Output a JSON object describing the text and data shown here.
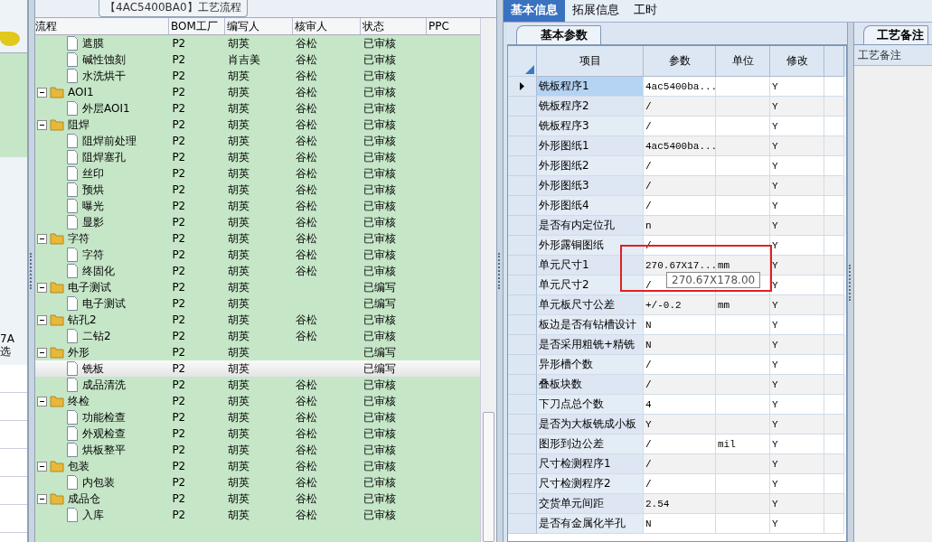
{
  "left_stub": {
    "texts": [
      "7A",
      "选"
    ]
  },
  "flow_panel": {
    "title": "【4AC5400BA0】工艺流程",
    "columns": [
      "流程",
      "BOM工厂",
      "编写人",
      "核审人",
      "状态",
      "PPC"
    ],
    "nodes": [
      {
        "kind": "continued",
        "children": [
          {
            "kind": "step",
            "name": "遮膜",
            "bom": "P2",
            "author": "胡英",
            "reviewer": "谷松",
            "status": "已审核",
            "selected": false
          },
          {
            "kind": "step",
            "name": "碱性蚀刻",
            "bom": "P2",
            "author": "肖吉美",
            "reviewer": "谷松",
            "status": "已审核",
            "selected": false
          },
          {
            "kind": "step",
            "name": "水洗烘干",
            "bom": "P2",
            "author": "胡英",
            "reviewer": "谷松",
            "status": "已审核",
            "selected": false
          }
        ]
      },
      {
        "kind": "group",
        "name": "AOI1",
        "bom": "P2",
        "author": "胡英",
        "reviewer": "谷松",
        "status": "已审核",
        "selected": false,
        "expanded": true,
        "children": [
          {
            "kind": "step",
            "name": "外层AOI1",
            "bom": "P2",
            "author": "胡英",
            "reviewer": "谷松",
            "status": "已审核",
            "selected": false
          }
        ]
      },
      {
        "kind": "group",
        "name": "阻焊",
        "bom": "P2",
        "author": "胡英",
        "reviewer": "谷松",
        "status": "已审核",
        "selected": false,
        "expanded": true,
        "children": [
          {
            "kind": "step",
            "name": "阻焊前处理",
            "bom": "P2",
            "author": "胡英",
            "reviewer": "谷松",
            "status": "已审核",
            "selected": false
          },
          {
            "kind": "step",
            "name": "阻焊塞孔",
            "bom": "P2",
            "author": "胡英",
            "reviewer": "谷松",
            "status": "已审核",
            "selected": false
          },
          {
            "kind": "step",
            "name": "丝印",
            "bom": "P2",
            "author": "胡英",
            "reviewer": "谷松",
            "status": "已审核",
            "selected": false
          },
          {
            "kind": "step",
            "name": "预烘",
            "bom": "P2",
            "author": "胡英",
            "reviewer": "谷松",
            "status": "已审核",
            "selected": false
          },
          {
            "kind": "step",
            "name": "曝光",
            "bom": "P2",
            "author": "胡英",
            "reviewer": "谷松",
            "status": "已审核",
            "selected": false
          },
          {
            "kind": "step",
            "name": "显影",
            "bom": "P2",
            "author": "胡英",
            "reviewer": "谷松",
            "status": "已审核",
            "selected": false
          }
        ]
      },
      {
        "kind": "group",
        "name": "字符",
        "bom": "P2",
        "author": "胡英",
        "reviewer": "谷松",
        "status": "已审核",
        "selected": false,
        "expanded": true,
        "children": [
          {
            "kind": "step",
            "name": "字符",
            "bom": "P2",
            "author": "胡英",
            "reviewer": "谷松",
            "status": "已审核",
            "selected": false
          },
          {
            "kind": "step",
            "name": "终固化",
            "bom": "P2",
            "author": "胡英",
            "reviewer": "谷松",
            "status": "已审核",
            "selected": false
          }
        ]
      },
      {
        "kind": "group",
        "name": "电子测试",
        "bom": "P2",
        "author": "胡英",
        "status": "已编写",
        "selected": false,
        "expanded": true,
        "children": [
          {
            "kind": "step",
            "name": "电子测试",
            "bom": "P2",
            "author": "胡英",
            "status": "已编写",
            "selected": false
          }
        ]
      },
      {
        "kind": "group",
        "name": "钻孔2",
        "bom": "P2",
        "author": "胡英",
        "reviewer": "谷松",
        "status": "已审核",
        "selected": false,
        "expanded": true,
        "children": [
          {
            "kind": "step",
            "name": "二钻2",
            "bom": "P2",
            "author": "胡英",
            "reviewer": "谷松",
            "status": "已审核",
            "selected": false
          }
        ]
      },
      {
        "kind": "group",
        "name": "外形",
        "bom": "P2",
        "author": "胡英",
        "status": "已编写",
        "selected": false,
        "expanded": true,
        "children": [
          {
            "kind": "step",
            "name": "铣板",
            "bom": "P2",
            "author": "胡英",
            "status": "已编写",
            "selected": true
          },
          {
            "kind": "step",
            "name": "成品清洗",
            "bom": "P2",
            "author": "胡英",
            "reviewer": "谷松",
            "status": "已审核",
            "selected": false
          }
        ]
      },
      {
        "kind": "group",
        "name": "终检",
        "bom": "P2",
        "author": "胡英",
        "reviewer": "谷松",
        "status": "已审核",
        "selected": false,
        "expanded": true,
        "children": [
          {
            "kind": "step",
            "name": "功能检查",
            "bom": "P2",
            "author": "胡英",
            "reviewer": "谷松",
            "status": "已审核",
            "selected": false
          },
          {
            "kind": "step",
            "name": "外观检查",
            "bom": "P2",
            "author": "胡英",
            "reviewer": "谷松",
            "status": "已审核",
            "selected": false
          },
          {
            "kind": "step",
            "name": "烘板整平",
            "bom": "P2",
            "author": "胡英",
            "reviewer": "谷松",
            "status": "已审核",
            "selected": false
          }
        ]
      },
      {
        "kind": "group",
        "name": "包装",
        "bom": "P2",
        "author": "胡英",
        "reviewer": "谷松",
        "status": "已审核",
        "selected": false,
        "expanded": true,
        "children": [
          {
            "kind": "step",
            "name": "内包装",
            "bom": "P2",
            "author": "胡英",
            "reviewer": "谷松",
            "status": "已审核",
            "selected": false
          }
        ]
      },
      {
        "kind": "group",
        "name": "成品仓",
        "bom": "P2",
        "author": "胡英",
        "reviewer": "谷松",
        "status": "已审核",
        "selected": false,
        "expanded": true,
        "children": [
          {
            "kind": "step",
            "name": "入库",
            "bom": "P2",
            "author": "胡英",
            "reviewer": "谷松",
            "status": "已审核",
            "selected": false
          }
        ]
      }
    ]
  },
  "tabs": [
    {
      "label": "基本信息",
      "selected": true
    },
    {
      "label": "拓展信息",
      "selected": false
    },
    {
      "label": "工时",
      "selected": false
    }
  ],
  "params_panel": {
    "tab": "基本参数",
    "columns": [
      "项目",
      "参数",
      "单位",
      "修改"
    ],
    "rows": [
      {
        "item": "铣板程序1",
        "value": "4ac5400ba...",
        "modify": "Y",
        "selected": true
      },
      {
        "item": "铣板程序2",
        "value": "/",
        "modify": "Y",
        "selected": false
      },
      {
        "item": "铣板程序3",
        "value": "/",
        "modify": "Y",
        "selected": false
      },
      {
        "item": "外形图纸1",
        "value": "4ac5400ba...",
        "modify": "Y",
        "selected": false
      },
      {
        "item": "外形图纸2",
        "value": "/",
        "modify": "Y",
        "selected": false
      },
      {
        "item": "外形图纸3",
        "value": "/",
        "modify": "Y",
        "selected": false
      },
      {
        "item": "外形图纸4",
        "value": "/",
        "modify": "Y",
        "selected": false
      },
      {
        "item": "是否有内定位孔",
        "value": "n",
        "modify": "Y",
        "selected": false
      },
      {
        "item": "外形露铜图纸",
        "value": "/",
        "modify": "Y",
        "selected": false
      },
      {
        "item": "单元尺寸1",
        "value": "270.67X17...",
        "unit": "mm",
        "modify": "Y",
        "selected": false
      },
      {
        "item": "单元尺寸2",
        "value": "/",
        "modify": "Y",
        "selected": false
      },
      {
        "item": "单元板尺寸公差",
        "value": "+/-0.2",
        "unit": "mm",
        "modify": "Y",
        "selected": false
      },
      {
        "item": "板边是否有钻槽设计",
        "value": "N",
        "modify": "Y",
        "selected": false
      },
      {
        "item": "是否采用粗铣+精铣",
        "value": "N",
        "modify": "Y",
        "selected": false
      },
      {
        "item": "异形槽个数",
        "value": "/",
        "modify": "Y",
        "selected": false
      },
      {
        "item": "叠板块数",
        "value": "/",
        "modify": "Y",
        "selected": false
      },
      {
        "item": "下刀点总个数",
        "value": "4",
        "modify": "Y",
        "selected": false
      },
      {
        "item": "是否为大板铣成小板",
        "value": "Y",
        "modify": "Y",
        "selected": false
      },
      {
        "item": "图形到边公差",
        "value": "/",
        "unit": "mil",
        "modify": "Y",
        "selected": false
      },
      {
        "item": "尺寸检测程序1",
        "value": "/",
        "modify": "Y",
        "selected": false
      },
      {
        "item": "尺寸检测程序2",
        "value": "/",
        "modify": "Y",
        "selected": false
      },
      {
        "item": "交货单元间距",
        "value": "2.54",
        "modify": "Y",
        "selected": false
      },
      {
        "item": "是否有金属化半孔",
        "value": "N",
        "modify": "Y",
        "selected": false
      }
    ],
    "tooltip": "270.67X178.00"
  },
  "notes_panel": {
    "tab": "工艺备注",
    "header": "工艺备注"
  }
}
